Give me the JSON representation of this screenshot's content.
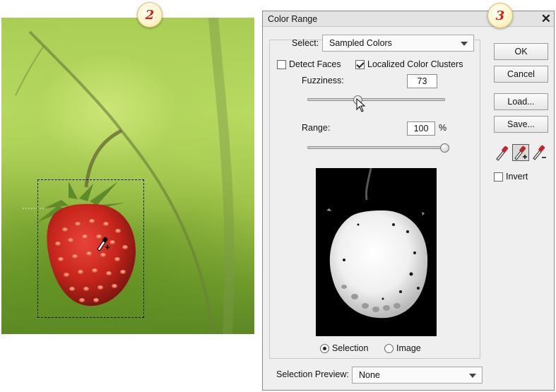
{
  "badges": {
    "left": "2",
    "right": "3"
  },
  "dialog": {
    "title": "Color Range",
    "close_glyph": "✕",
    "select": {
      "label_text": "Select:",
      "value": "Sampled Colors"
    },
    "detect_faces": {
      "label": "Detect Faces",
      "checked": false
    },
    "localized_clusters": {
      "label": "Localized Color Clusters",
      "checked": true
    },
    "fuzziness": {
      "label": "Fuzziness:",
      "value": "73"
    },
    "range": {
      "label": "Range:",
      "value": "100",
      "unit": "%"
    },
    "view_mode": {
      "options": [
        {
          "label": "Selection",
          "selected": true
        },
        {
          "label": "Image",
          "selected": false
        }
      ]
    },
    "selection_preview": {
      "label_text": "Selection Preview:",
      "value": "None"
    },
    "buttons": {
      "ok": "OK",
      "cancel": "Cancel",
      "load": "Load...",
      "save": "Save..."
    },
    "tools": [
      "eyedropper-icon",
      "eyedropper-plus-icon",
      "eyedropper-minus-icon"
    ],
    "invert": {
      "label": "Invert",
      "checked": false
    }
  },
  "colors": {
    "badge_text": "#d2211a",
    "strawberry": "#c8261c",
    "preview_bg": "#000000"
  }
}
